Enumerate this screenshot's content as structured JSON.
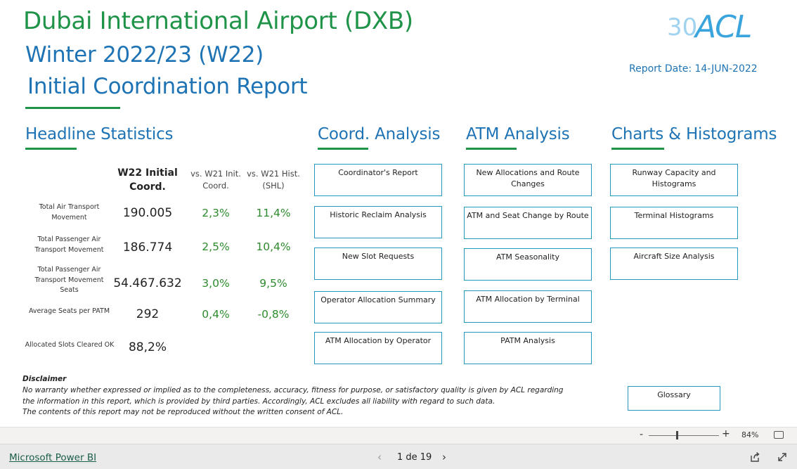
{
  "report": {
    "title_airport": "Dubai International Airport (DXB)",
    "title_season": "Winter 2022/23 (W22)",
    "title_report": "Initial Coordination Report",
    "report_date": "Report Date: 14-JUN-2022",
    "logo_text": "ACL",
    "logo_anniversary": "30"
  },
  "colors": {
    "green": "#1f9348",
    "blue": "#1e73b4",
    "button_border": "#2596be",
    "positive": "#2e8b2e"
  },
  "headline": {
    "title": "Headline Statistics",
    "col1": [
      "W22 Initial",
      "Coord."
    ],
    "col2": [
      "vs. W21 Init.",
      "Coord."
    ],
    "col3": [
      "vs. W21 Hist.",
      "(SHL)"
    ],
    "rows": [
      {
        "label": [
          "Total Air Transport",
          "Movement"
        ],
        "value": "190.005",
        "vs_init": "2,3%",
        "vs_hist": "11,4%"
      },
      {
        "label": [
          "Total Passenger Air",
          "Transport Movement"
        ],
        "value": "186.774",
        "vs_init": "2,5%",
        "vs_hist": "10,4%"
      },
      {
        "label": [
          "Total Passenger Air",
          "Transport Movement",
          "Seats"
        ],
        "value": "54.467.632",
        "vs_init": "3,0%",
        "vs_hist": "9,5%"
      },
      {
        "label": [
          "Average Seats per PATM"
        ],
        "value": "292",
        "vs_init": "0,4%",
        "vs_hist": "-0,8%"
      },
      {
        "label": [
          "Allocated Slots Cleared OK"
        ],
        "value": "88,2%",
        "vs_init": "",
        "vs_hist": ""
      }
    ]
  },
  "coord": {
    "title": "Coord. Analysis",
    "buttons": [
      "Coordinator's Report",
      "Historic Reclaim Analysis",
      "New Slot Requests",
      "Operator Allocation Summary",
      "ATM Allocation by Operator"
    ]
  },
  "atm": {
    "title": "ATM Analysis",
    "buttons": [
      [
        "New Allocations and Route",
        "Changes"
      ],
      [
        "ATM and Seat Change by Route"
      ],
      [
        "ATM Seasonality"
      ],
      [
        "ATM Allocation by Terminal"
      ],
      [
        "PATM Analysis"
      ]
    ]
  },
  "charts": {
    "title": "Charts & Histograms",
    "buttons": [
      [
        "Runway Capacity and",
        "Histograms"
      ],
      [
        "Terminal Histograms"
      ],
      [
        "Aircraft Size Analysis"
      ]
    ]
  },
  "glossary": "Glossary",
  "disclaimer": {
    "title": "Disclaimer",
    "lines": [
      "No warranty whether expressed or implied as to the completeness, accuracy, fitness for purpose, or satisfactory quality is given by ACL regarding",
      "the information in this report, which is provided by third parties. Accordingly, ACL excludes all liability with regard to such data.",
      "The contents of this report may not be reproduced without the written consent of ACL."
    ]
  },
  "zoom": {
    "minus": "-",
    "plus": "+",
    "percent": "84%",
    "level": 0.4
  },
  "footer": {
    "app_link": "Microsoft Power BI",
    "page_indicator": "1 de 19",
    "prev": "‹",
    "next": "›"
  }
}
